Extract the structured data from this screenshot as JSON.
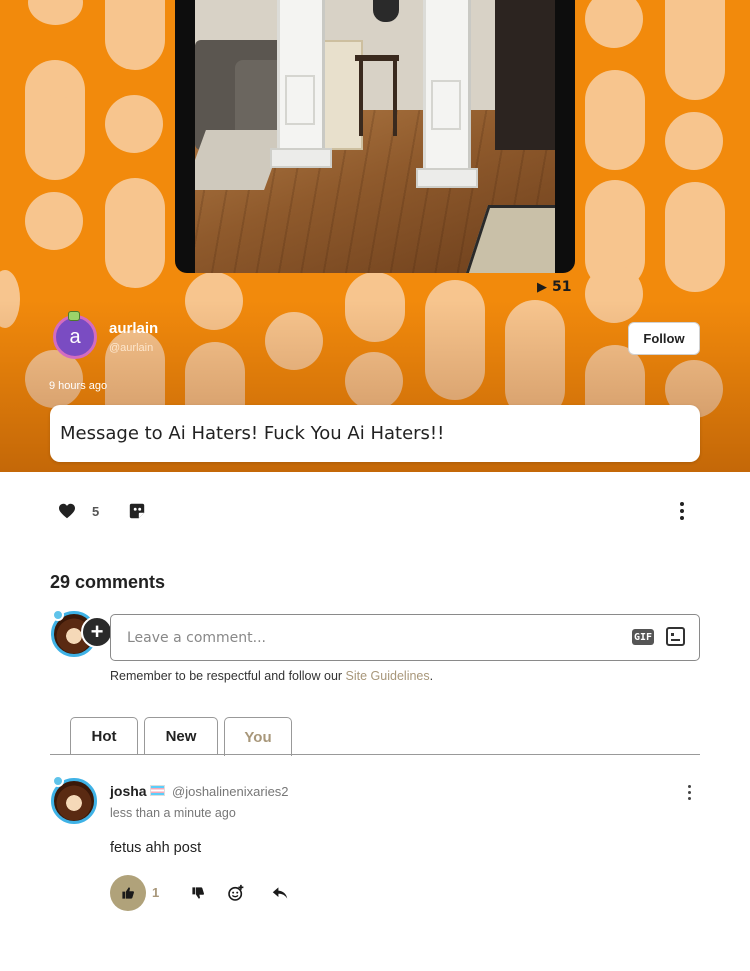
{
  "video": {
    "views": "51"
  },
  "author": {
    "avatar_letter": "a",
    "name": "aurlain",
    "handle": "@aurlain",
    "posted": "9 hours ago",
    "follow_label": "Follow"
  },
  "post": {
    "caption": "Message to Ai Haters! Fuck You Ai Haters!!"
  },
  "actions": {
    "like_count": "5",
    "icons": [
      "heart-icon",
      "share-icon",
      "more-options-icon"
    ]
  },
  "comments": {
    "count_label": "29 comments",
    "input_placeholder": "Leave a comment...",
    "gif_label": "GIF",
    "guidelines_text": "Remember to be respectful and follow our ",
    "guidelines_link": "Site Guidelines",
    "guidelines_end": "."
  },
  "tabs": [
    {
      "label": "Hot"
    },
    {
      "label": "New"
    },
    {
      "label": "You",
      "active": true
    }
  ],
  "comment_list": [
    {
      "name": "josha",
      "handle": "@joshalinenixaries2",
      "time": "less than a minute ago",
      "text": "fetus ahh post",
      "upvotes": "1"
    }
  ],
  "colors": {
    "hero_orange": "#f28a0c",
    "pattern": "#f7c58e",
    "accent_tan": "#a8977a",
    "upvote_fill": "#b0a27a"
  }
}
